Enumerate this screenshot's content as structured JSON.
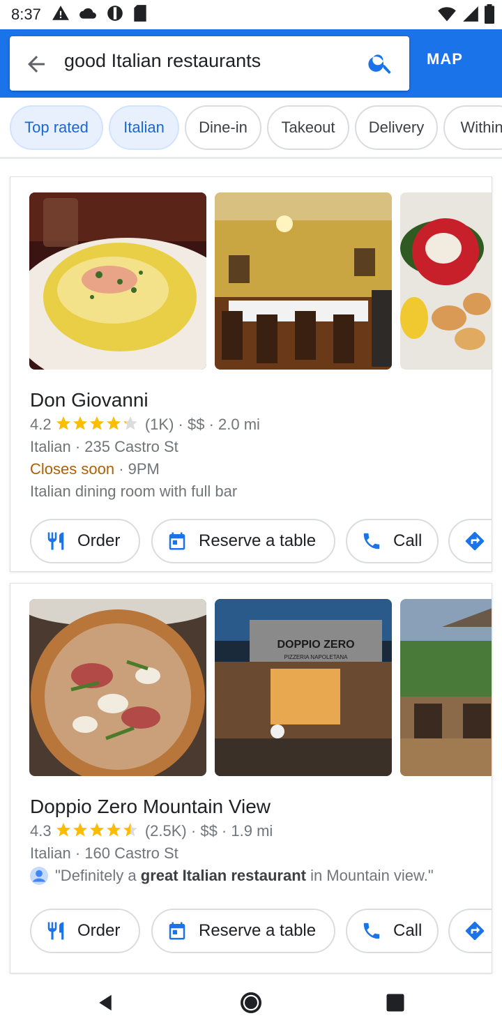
{
  "status_bar": {
    "time": "8:37"
  },
  "search": {
    "query": "good Italian restaurants",
    "map_label": "MAP"
  },
  "chips": [
    "Top rated",
    "Italian",
    "Dine-in",
    "Takeout",
    "Delivery",
    "Within"
  ],
  "colors": {
    "accent": "#1a73e8",
    "star": "#fbbc04",
    "closes_soon": "#b06000"
  },
  "restaurants": [
    {
      "name": "Don Giovanni",
      "rating": "4.2",
      "stars": 4.2,
      "reviews": "(1K)",
      "price": "$$",
      "distance": "2.0 mi",
      "category": "Italian",
      "address": "235 Castro St",
      "status": "Closes soon",
      "hours": "9PM",
      "description": "Italian dining room with full bar",
      "actions": [
        "Order",
        "Reserve a table",
        "Call"
      ]
    },
    {
      "name": "Doppio Zero Mountain View",
      "rating": "4.3",
      "stars": 4.5,
      "reviews": "(2.5K)",
      "price": "$$",
      "distance": "1.9 mi",
      "category": "Italian",
      "address": "160 Castro St",
      "review_pre": "\"Definitely a ",
      "review_bold": "great Italian restaurant",
      "review_post": " in Mountain view.\"",
      "sign_text": "DOPPIO ZERO",
      "sign_sub": "PIZZERIA NAPOLETANA",
      "actions": [
        "Order",
        "Reserve a table",
        "Call"
      ]
    }
  ]
}
